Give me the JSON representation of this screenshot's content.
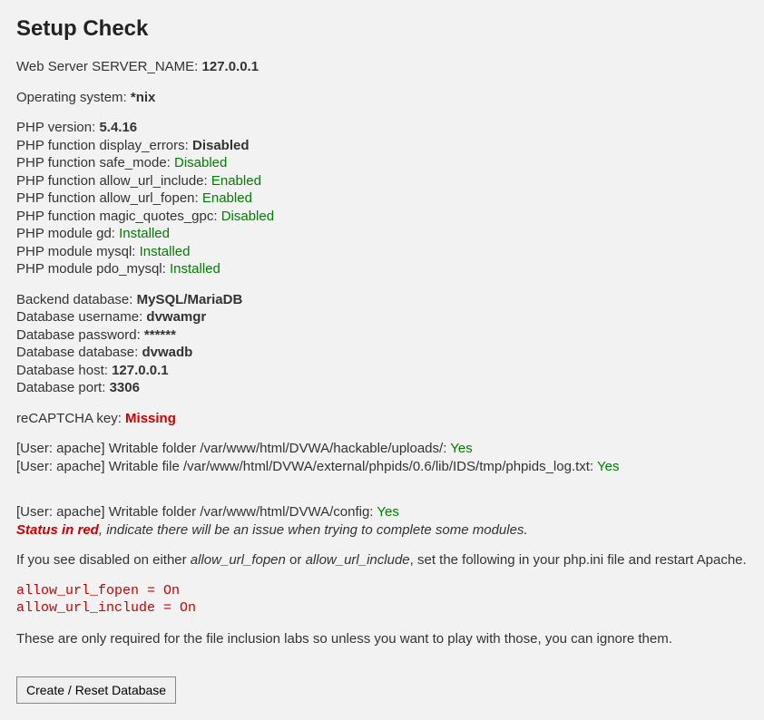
{
  "title": "Setup Check",
  "server": {
    "server_name_label": "Web Server SERVER_NAME: ",
    "server_name_value": "127.0.0.1",
    "os_label": "Operating system: ",
    "os_value": "*nix"
  },
  "php": {
    "version_label": "PHP version: ",
    "version_value": "5.4.16",
    "display_errors_label": "PHP function display_errors: ",
    "display_errors_value": "Disabled",
    "safe_mode_label": "PHP function safe_mode: ",
    "safe_mode_value": "Disabled",
    "allow_url_include_label": "PHP function allow_url_include: ",
    "allow_url_include_value": "Enabled",
    "allow_url_fopen_label": "PHP function allow_url_fopen: ",
    "allow_url_fopen_value": "Enabled",
    "magic_quotes_gpc_label": "PHP function magic_quotes_gpc: ",
    "magic_quotes_gpc_value": "Disabled",
    "module_gd_label": "PHP module gd: ",
    "module_gd_value": "Installed",
    "module_mysql_label": "PHP module mysql: ",
    "module_mysql_value": "Installed",
    "module_pdo_mysql_label": "PHP module pdo_mysql: ",
    "module_pdo_mysql_value": "Installed"
  },
  "db": {
    "backend_label": "Backend database: ",
    "backend_value": "MySQL/MariaDB",
    "username_label": "Database username: ",
    "username_value": "dvwamgr",
    "password_label": "Database password: ",
    "password_value": "******",
    "database_label": "Database database: ",
    "database_value": "dvwadb",
    "host_label": "Database host: ",
    "host_value": "127.0.0.1",
    "port_label": "Database port: ",
    "port_value": "3306"
  },
  "recaptcha": {
    "label": "reCAPTCHA key: ",
    "value": "Missing"
  },
  "writable": {
    "uploads_label": "[User: apache] Writable folder /var/www/html/DVWA/hackable/uploads/: ",
    "uploads_value": "Yes",
    "phpids_label": "[User: apache] Writable file /var/www/html/DVWA/external/phpids/0.6/lib/IDS/tmp/phpids_log.txt: ",
    "phpids_value": "Yes",
    "config_label": "[User: apache] Writable folder /var/www/html/DVWA/config: ",
    "config_value": "Yes"
  },
  "notes": {
    "status_red": "Status in red",
    "status_red_rest": ", indicate there will be an issue when trying to complete some modules.",
    "disabled_prefix": "If you see disabled on either ",
    "allow_url_fopen_it": "allow_url_fopen",
    "or_text": " or ",
    "allow_url_include_it": "allow_url_include",
    "disabled_suffix": ", set the following in your php.ini file and restart Apache.",
    "code_line1": "allow_url_fopen = On",
    "code_line2": "allow_url_include = On",
    "footer_note": "These are only required for the file inclusion labs so unless you want to play with those, you can ignore them."
  },
  "button_label": "Create / Reset Database"
}
